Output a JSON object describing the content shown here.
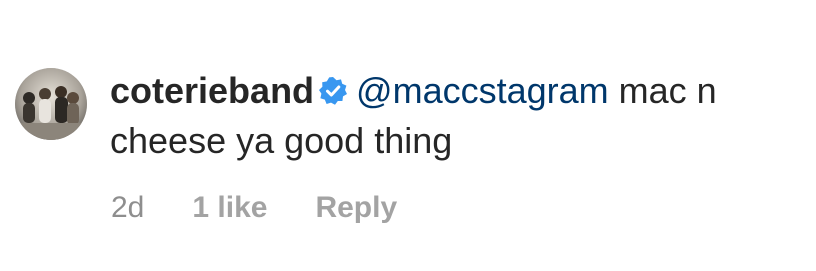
{
  "comment": {
    "avatar_icon": "band-group-photo",
    "username": "coterieband",
    "verified_icon": "verified-badge-icon",
    "verified_color": "#3897f0",
    "mention": "@maccstagram",
    "text": " mac n cheese ya good thing",
    "mention_color": "#00376b",
    "meta": {
      "time": "2d",
      "likes": "1 like",
      "reply": "Reply"
    }
  }
}
